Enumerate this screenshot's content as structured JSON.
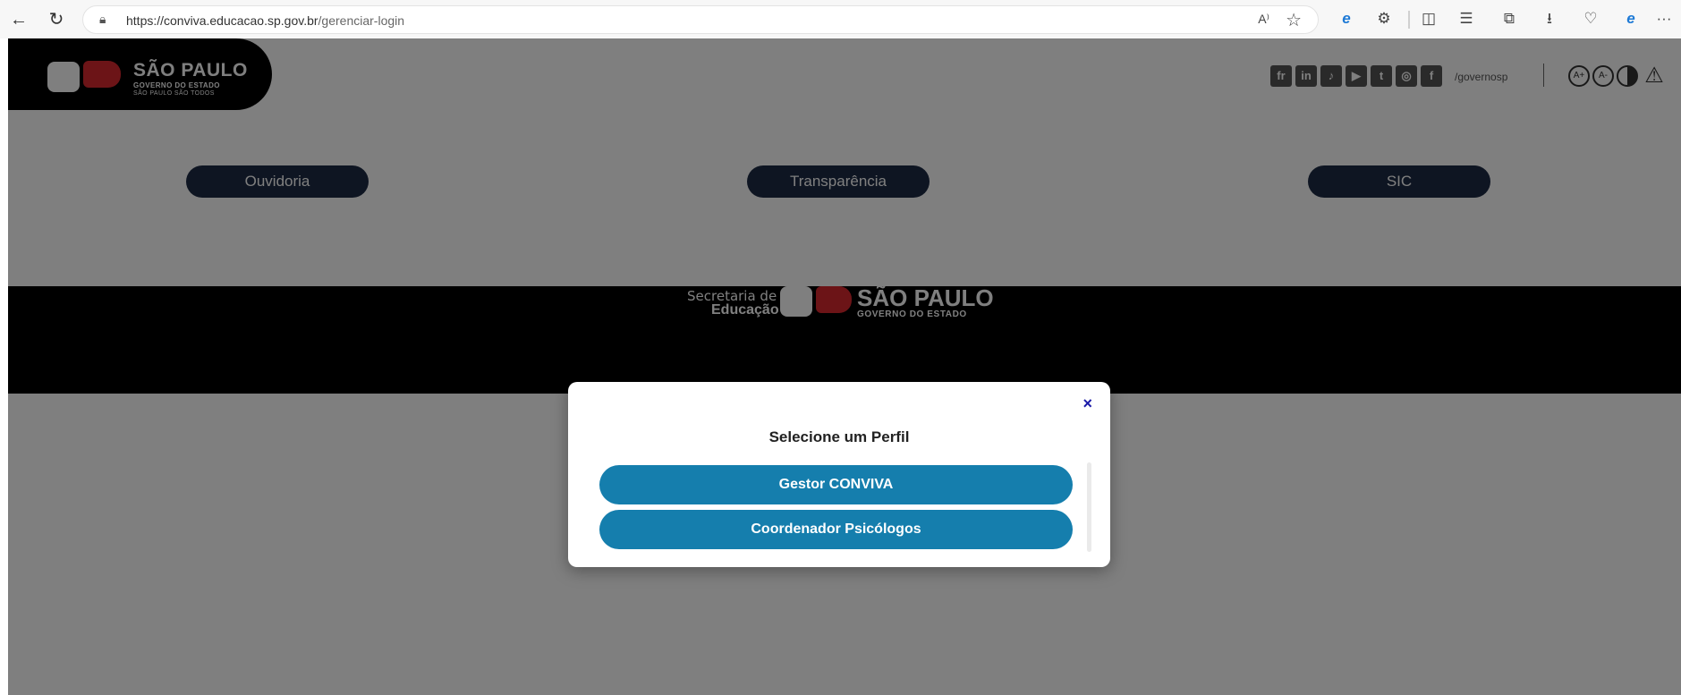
{
  "browser": {
    "url_host": "https://conviva.educacao.sp.gov.br",
    "url_path": "/gerenciar-login",
    "toolbar_icons": [
      "back-icon",
      "reload-icon",
      "read-aloud-icon",
      "favorite-icon",
      "edge-icon",
      "extensions-icon",
      "split-screen-icon",
      "favorites-list-icon",
      "collections-icon",
      "download-icon",
      "heart-icon",
      "ie-mode-icon",
      "more-icon"
    ],
    "read_aloud": "A⁾",
    "more": "···"
  },
  "header": {
    "logo_title": "SÃO PAULO",
    "logo_sub1": "GOVERNO DO ESTADO",
    "logo_sub2": "SÃO PAULO SÃO TODOS",
    "social": [
      "fr",
      "in",
      "♪",
      "▶",
      "t",
      "◎",
      "f"
    ],
    "handle": "/governosp",
    "accessibility": [
      "A+",
      "A-",
      "",
      ""
    ]
  },
  "links": {
    "ouvidoria": "Ouvidoria",
    "transparencia": "Transparência",
    "sic": "SIC"
  },
  "footer": {
    "secretaria": "Secretaria de",
    "educacao": "Educação",
    "title": "SÃO PAULO",
    "sub": "GOVERNO DO ESTADO"
  },
  "modal": {
    "title": "Selecione um Perfil",
    "close": "×",
    "options": [
      "Gestor CONVIVA",
      "Coordenador Psicólogos"
    ]
  },
  "colors": {
    "primary_button": "#157ead",
    "link_pill": "#1d2b44",
    "overlay": "rgba(0,0,0,0.5)",
    "brand_red": "#d9282f"
  }
}
